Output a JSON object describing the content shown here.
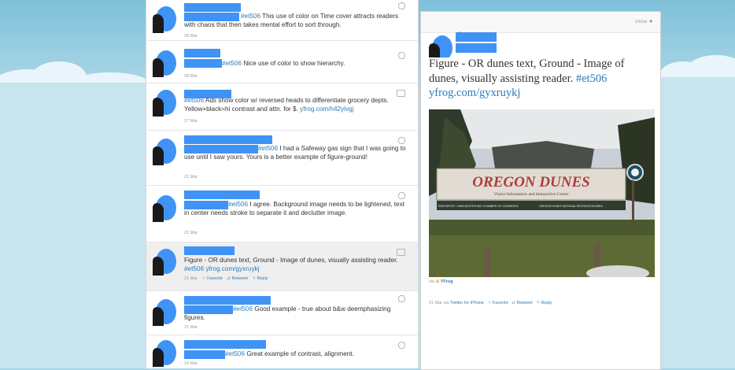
{
  "tweets": [
    {
      "hashtag": "#et506",
      "text": " This use of color on Time cover attracts readers with chaos that then takes mental effort to sort through.",
      "date": "28 Mar"
    },
    {
      "hashtag": "#et506",
      "text": " Nice use of color to show hierarchy.",
      "date": "28 Mar"
    },
    {
      "hashtag": "#et506",
      "text": " Ads show color w/ reversed heads to differentiate grocery depts. Yellow+black=hi contrast and attn. for $. ",
      "link": "yfrog.com/h42ylvgj",
      "date": "27 Mar"
    },
    {
      "hashtag": "#et506",
      "text": " I had a Safeway gas sign that I was going to use until I saw yours. Yours is a better example of figure-ground!",
      "date": "21 Mar"
    },
    {
      "hashtag": "#et506",
      "text": " I agree. Background image needs to be lightened, text in center needs stroke to separate it and declutter image.",
      "date": "21 Mar"
    },
    {
      "text": "Figure - OR dunes text, Ground - Image of dunes, visually assisting reader. ",
      "hashtag": "#et506",
      "link": "yfrog.com/gyxruykj",
      "date": "21 Mar",
      "favorite": "Favorite",
      "retweet": "Retweet",
      "reply": "Reply"
    },
    {
      "hashtag": "#et506",
      "text": " Good example - true about b&w deemphasizing figures.",
      "date": "21 Mar"
    },
    {
      "hashtag": "#et506",
      "text": " Great example of contrast, alignment.",
      "date": "14 Mar"
    }
  ],
  "detail": {
    "close_label": "close",
    "close_icon": "×",
    "at": "@",
    "text": "Figure - OR dunes text, Ground - Image of dunes, visually assisting reader. ",
    "hashtag": "#et506",
    "link": "yfrog.com/gyxruykj",
    "via_label": "via",
    "via_service": "YFrog",
    "meta": "21 Mar via ",
    "source": "Twitter for iPhone",
    "favorite": "Favorite",
    "retweet": "Retweet",
    "reply": "Reply",
    "photo": {
      "sign_title": "OREGON DUNES",
      "sign_sub": "Visitor Information and Interpretive Center",
      "sign_left": "REEDSPORT / WINCHESTER BAY CHAMBER OF COMMERCE",
      "sign_right": "OREGON DUNES NATIONAL RECREATION AREA"
    }
  }
}
